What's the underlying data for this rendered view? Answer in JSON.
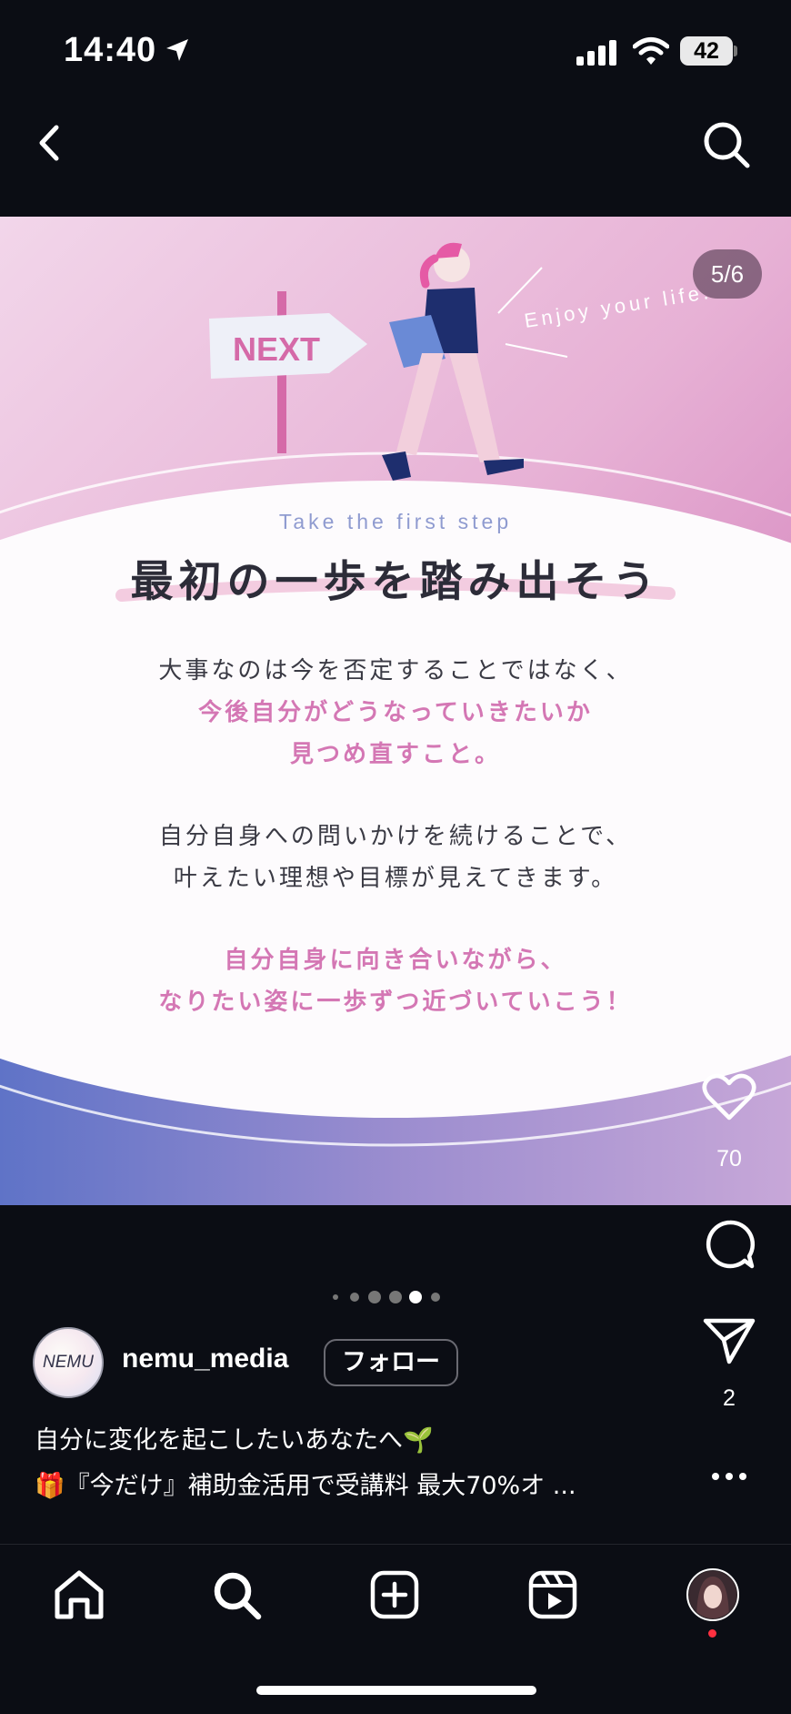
{
  "status_bar": {
    "time": "14:40",
    "battery_level": "42",
    "icons": [
      "location-arrow-icon",
      "cellular-signal-icon",
      "wifi-icon",
      "battery-icon"
    ]
  },
  "header": {
    "icons": [
      "back-chevron-icon",
      "search-icon"
    ]
  },
  "post": {
    "slide_counter": "5/6",
    "current_slide": 5,
    "total_slides": 6,
    "slide": {
      "sign_text": "NEXT",
      "tagline": "Enjoy your life.",
      "subtitle": "Take the first step",
      "headline": "最初の一歩を踏み出そう",
      "paragraph_1": [
        "大事なのは今を否定することではなく、"
      ],
      "paragraph_1_highlight": [
        "今後自分がどうなっていきたいか",
        "見つめ直すこと。"
      ],
      "paragraph_2": [
        "自分自身への問いかけを続けることで、",
        "叶えたい理想や目標が見えてきます。"
      ],
      "paragraph_3_highlight": [
        "自分自身に向き合いながら、",
        "なりたい姿に一歩ずつ近づいていこう！"
      ]
    },
    "actions": {
      "like_count": "70",
      "share_count": "2",
      "icons": [
        "heart-icon",
        "comment-icon",
        "send-icon",
        "more-icon"
      ]
    },
    "carousel_dots": 6,
    "active_dot": 4
  },
  "author": {
    "avatar_text": "NEMU",
    "username": "nemu_media",
    "follow_label": "フォロー"
  },
  "caption": {
    "line_1": "自分に変化を起こしたいあなたへ🌱",
    "line_2": "🎁『今だけ』補助金活用で受講料 最大70%オ ..."
  },
  "bottom_nav": {
    "items": [
      "home-icon",
      "search-icon",
      "create-post-icon",
      "reels-icon",
      "profile-avatar"
    ]
  },
  "colors": {
    "background": "#0b0d14",
    "accent_pink": "#d477b4",
    "navy": "#1e2e6e",
    "notification_dot": "#ff3040"
  }
}
